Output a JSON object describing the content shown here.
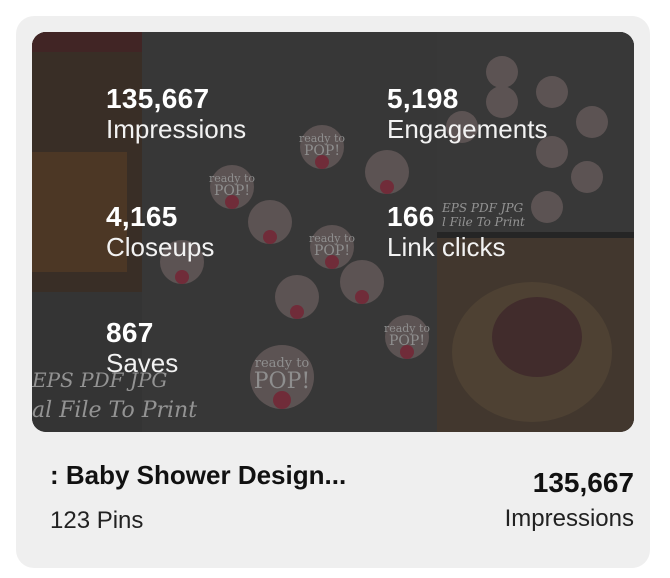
{
  "board": {
    "title": ": Baby Shower Design...",
    "pins": "123 Pins",
    "total_value": "135,667",
    "total_label": "Impressions"
  },
  "overlay_stats": [
    {
      "value": "135,667",
      "label": "Impressions"
    },
    {
      "value": "5,198",
      "label": "Engagements"
    },
    {
      "value": "4,165",
      "label": "Closeups"
    },
    {
      "value": "166",
      "label": "Link clicks"
    },
    {
      "value": "867",
      "label": "Saves"
    }
  ],
  "cover_art": {
    "sticker_text_line1": "ready to",
    "sticker_text_line2": "POP!",
    "caption_line1": "EPS PDF JPG",
    "caption_line2": "al File To Print",
    "caption_small_1": "EPS PDF JPG",
    "caption_small_2": "l File To Print"
  }
}
